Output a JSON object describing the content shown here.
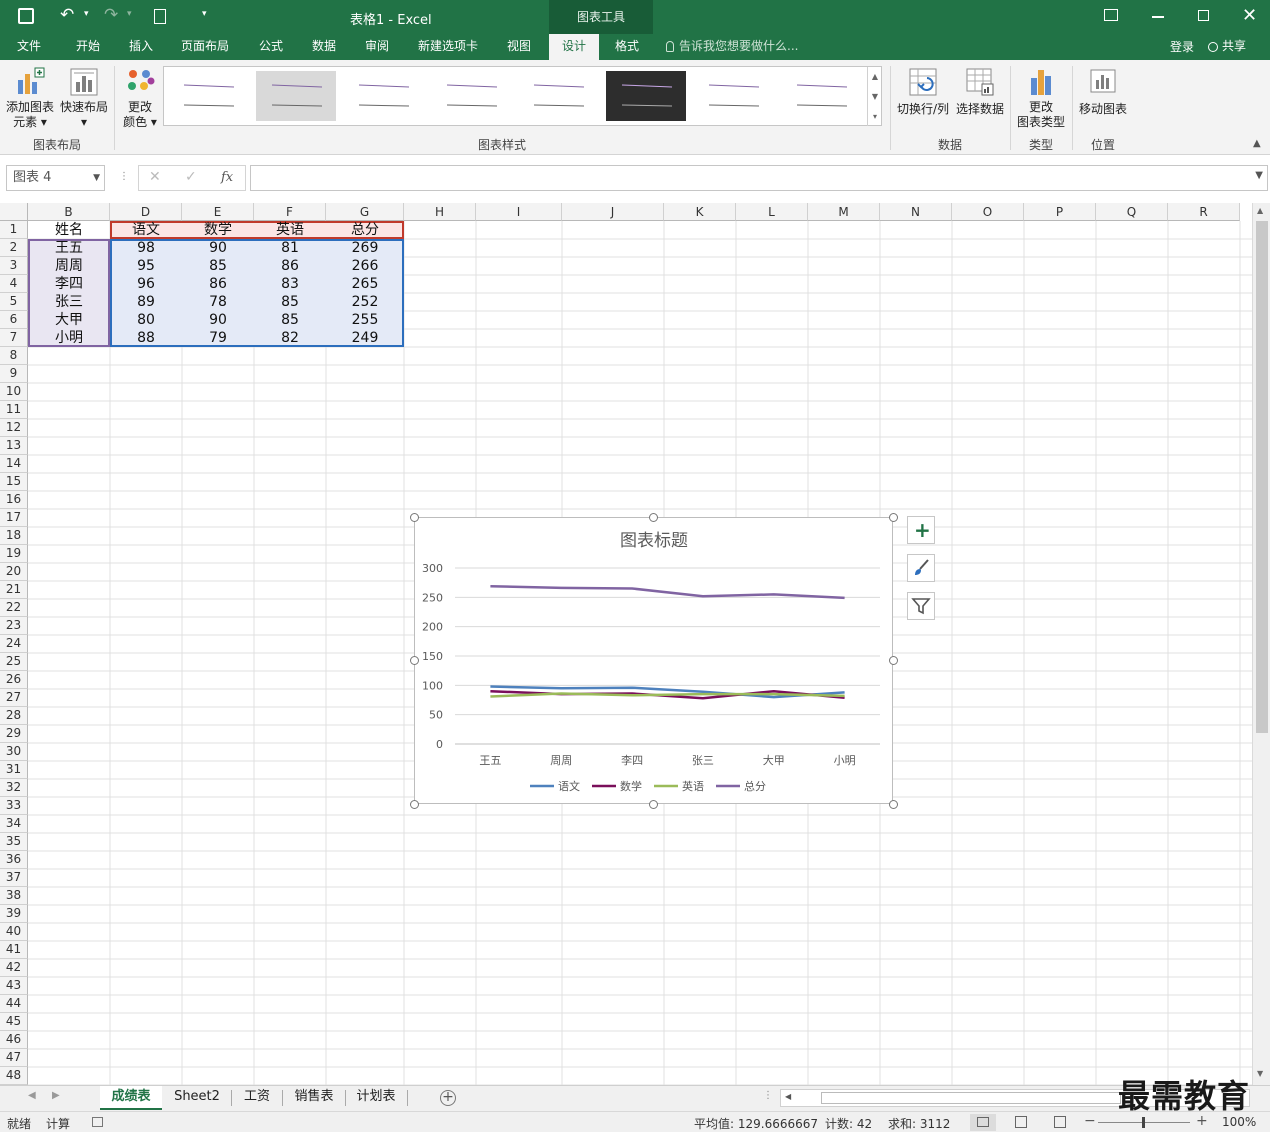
{
  "window": {
    "title": "表格1 - Excel",
    "context_tab_group": "图表工具"
  },
  "tabs": [
    "文件",
    "开始",
    "插入",
    "页面布局",
    "公式",
    "数据",
    "审阅",
    "新建选项卡",
    "视图",
    "设计",
    "格式"
  ],
  "tell_me": "告诉我您想要做什么...",
  "account": {
    "login": "登录",
    "share": "共享"
  },
  "ribbon": {
    "add_element_1": "添加图表",
    "add_element_2": "元素",
    "quick_layout": "快速布局",
    "change_color_1": "更改",
    "change_color_2": "颜色",
    "group_layout": "图表布局",
    "group_styles": "图表样式",
    "switch_rowcol": "切换行/列",
    "select_data": "选择数据",
    "group_data": "数据",
    "change_type_1": "更改",
    "change_type_2": "图表类型",
    "group_type": "类型",
    "move_chart": "移动图表",
    "group_location": "位置"
  },
  "namebox": "图表 4",
  "fx": "fx",
  "columns": [
    "B",
    "D",
    "E",
    "F",
    "G",
    "H",
    "I",
    "J",
    "K",
    "L",
    "M",
    "N",
    "O",
    "P",
    "Q",
    "R"
  ],
  "table": {
    "headers": [
      "姓名",
      "语文",
      "数学",
      "英语",
      "总分"
    ],
    "rows": [
      [
        "王五",
        "98",
        "90",
        "81",
        "269"
      ],
      [
        "周周",
        "95",
        "85",
        "86",
        "266"
      ],
      [
        "李四",
        "96",
        "86",
        "83",
        "265"
      ],
      [
        "张三",
        "89",
        "78",
        "85",
        "252"
      ],
      [
        "大甲",
        "80",
        "90",
        "85",
        "255"
      ],
      [
        "小明",
        "88",
        "79",
        "82",
        "249"
      ]
    ]
  },
  "sheets": [
    "成绩表",
    "Sheet2",
    "工资",
    "销售表",
    "计划表"
  ],
  "status": {
    "ready": "就绪",
    "calc": "计算",
    "average": "平均值: 129.6666667",
    "count": "计数: 42",
    "sum": "求和: 3112",
    "zoom": "100%"
  },
  "watermark": "最需教育",
  "chart_data": {
    "type": "line",
    "title": "图表标题",
    "categories": [
      "王五",
      "周周",
      "李四",
      "张三",
      "大甲",
      "小明"
    ],
    "series": [
      {
        "name": "语文",
        "color": "#4e81bd",
        "values": [
          98,
          95,
          96,
          89,
          80,
          88
        ]
      },
      {
        "name": "数学",
        "color": "#7a0f5a",
        "values": [
          90,
          85,
          86,
          78,
          90,
          79
        ]
      },
      {
        "name": "英语",
        "color": "#9bbb59",
        "values": [
          81,
          86,
          83,
          85,
          85,
          82
        ]
      },
      {
        "name": "总分",
        "color": "#8064a2",
        "values": [
          269,
          266,
          265,
          252,
          255,
          249
        ]
      }
    ],
    "ylim": [
      0,
      300
    ],
    "yticks": [
      0,
      50,
      100,
      150,
      200,
      250,
      300
    ],
    "grid": true,
    "legend": "bottom"
  }
}
